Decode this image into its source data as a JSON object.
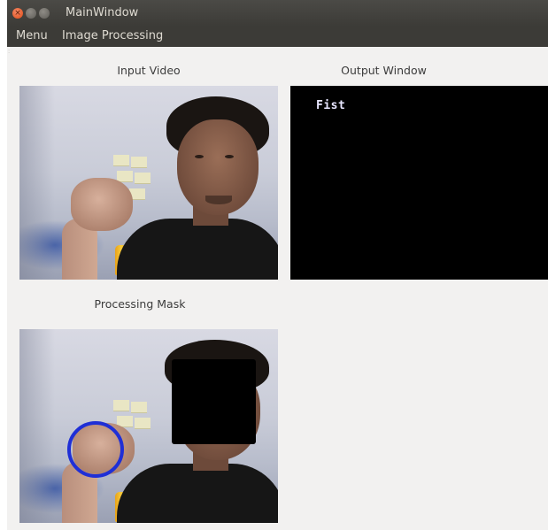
{
  "window": {
    "title": "MainWindow",
    "close_glyph": "×"
  },
  "menubar": {
    "items": [
      {
        "label": "Menu"
      },
      {
        "label": "Image Processing"
      }
    ]
  },
  "panels": {
    "input_video": {
      "label": "Input Video"
    },
    "output_window": {
      "label": "Output Window",
      "text": "Fist"
    },
    "processing_mask": {
      "label": "Processing Mask"
    }
  },
  "colors": {
    "detection_ring": "#1f2fd6",
    "output_background": "#000000",
    "titlebar": "#3c3b37"
  }
}
